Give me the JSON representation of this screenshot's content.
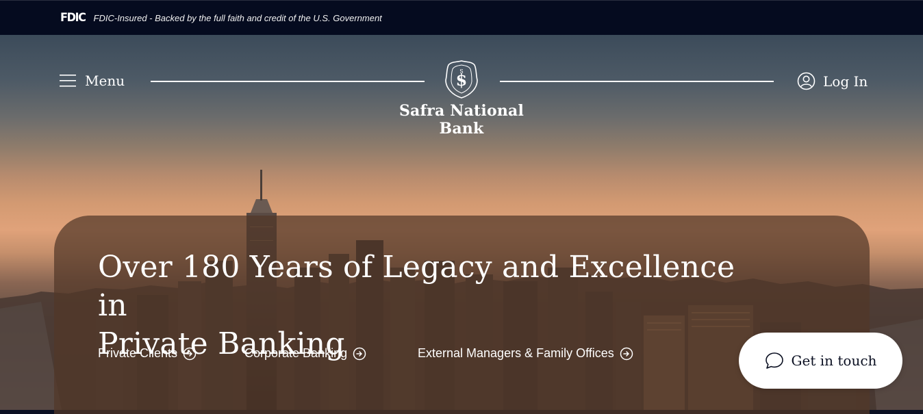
{
  "fdic": {
    "logo": "FDIC",
    "notice": "FDIC-Insured - Backed by the full faith and credit of the U.S. Government"
  },
  "header": {
    "menu_label": "Menu",
    "bank_name": "Safra National Bank",
    "login_label": "Log In"
  },
  "hero": {
    "headline_line1": "Over 180 Years of Legacy and Excellence in",
    "headline_line2": "Private Banking",
    "links": [
      {
        "label": "Private Clients"
      },
      {
        "label": "Corporate Banking"
      },
      {
        "label": "External Managers & Family Offices"
      }
    ]
  },
  "chat": {
    "label": "Get in touch"
  },
  "colors": {
    "fdic_bar": "#050b1f",
    "card": "#523828",
    "text": "#ffffff",
    "button_text": "#0b1022"
  },
  "icons": [
    "hamburger-icon",
    "bank-crest-icon",
    "user-circle-icon",
    "arrow-circle-right-icon",
    "chat-bubble-icon"
  ]
}
